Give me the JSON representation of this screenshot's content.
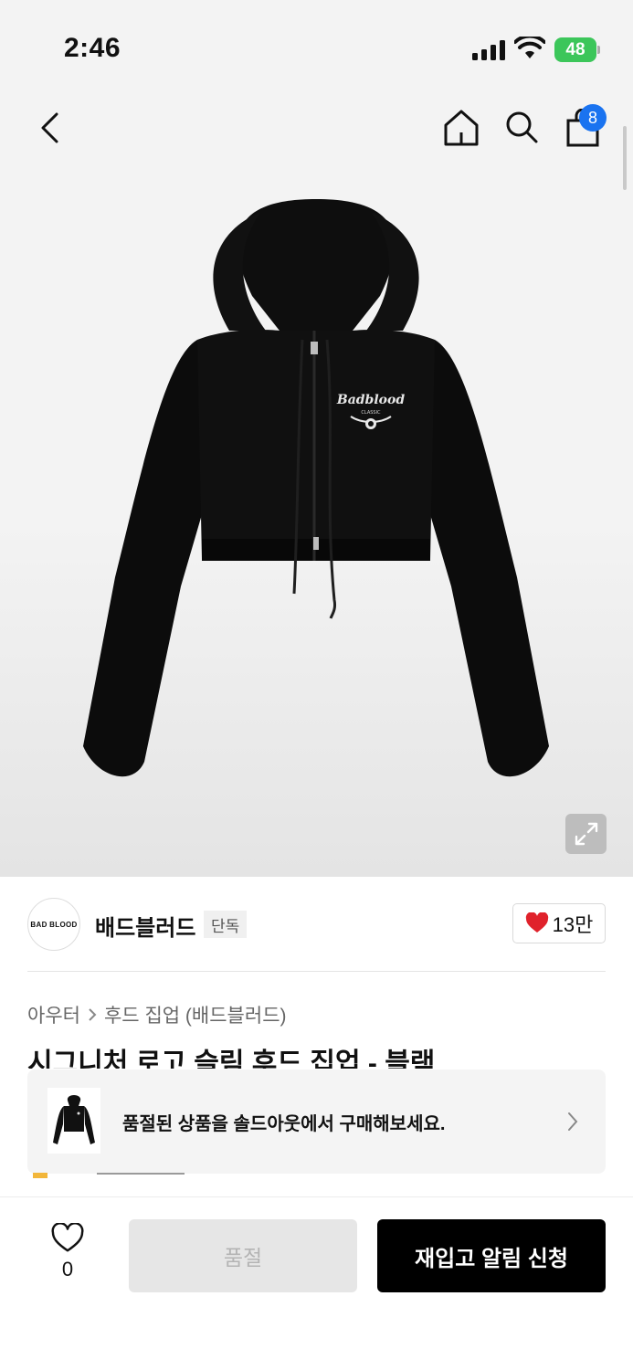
{
  "status_bar": {
    "time": "2:46",
    "battery": "48"
  },
  "nav": {
    "cart_count": "8"
  },
  "product_image": {
    "graphic_text": "Badblood",
    "graphic_subtext": "CLASSIC"
  },
  "brand": {
    "logo_text": "BAD BLOOD",
    "name": "배드블러드",
    "tag": "단독",
    "likes": "13만",
    "like_color": "#e0222b"
  },
  "breadcrumb": {
    "category": "아우터",
    "subcategory": "후드 집업 (배드블러드)"
  },
  "product": {
    "title": "시그니처 로고 슬림 후드 집업 - 블랙"
  },
  "soldout_banner": {
    "text": "품절된 상품을 솔드아웃에서 구매해보세요."
  },
  "bottom_bar": {
    "wish_count": "0",
    "soldout_label": "품절",
    "restock_label": "재입고 알림 신청"
  },
  "colors": {
    "accent_badge": "#1a73f0",
    "battery": "#3cc65a"
  }
}
